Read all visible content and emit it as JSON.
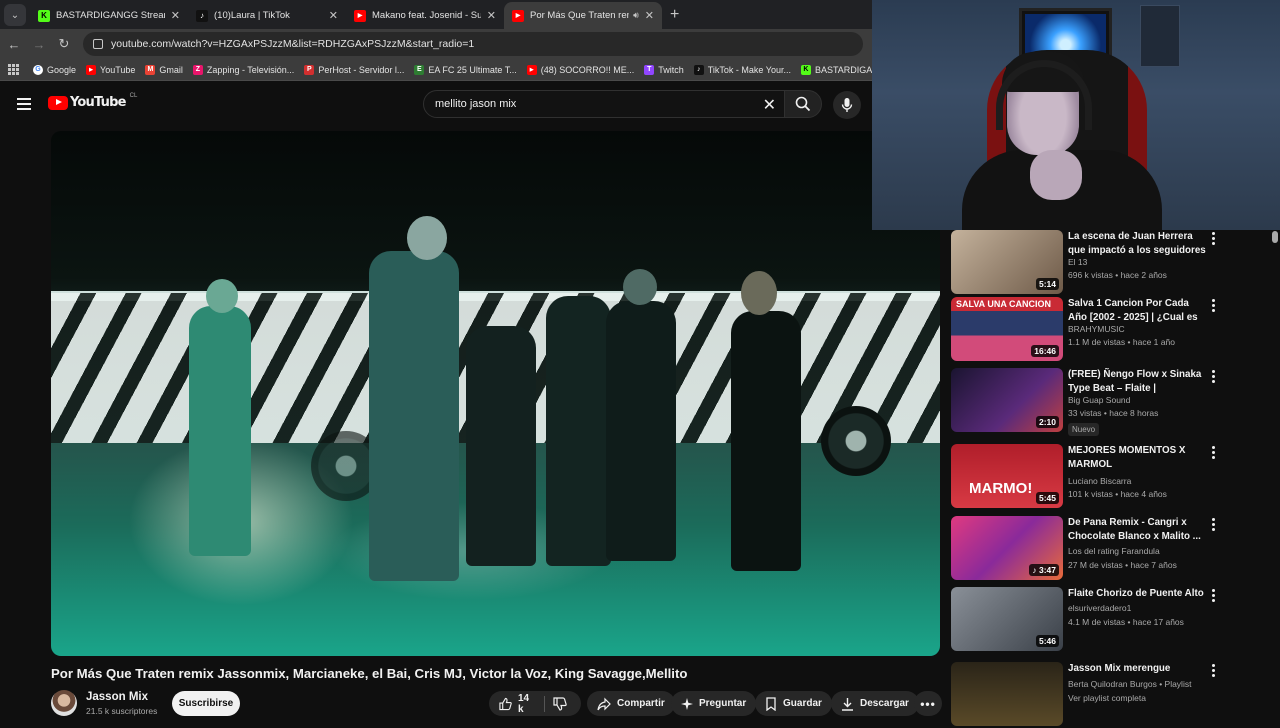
{
  "browser": {
    "tabs": [
      {
        "title": "BASTARDIGANGG Stream - Wat",
        "color": "#53fc18",
        "glyph": "K"
      },
      {
        "title": "(10)Laura | TikTok",
        "color": "#111111",
        "glyph": "♪"
      },
      {
        "title": "Makano feat. Josenid - Su Nom",
        "color": "#ff0000",
        "glyph": "▶"
      },
      {
        "title": "Por Más Que Traten remix J",
        "color": "#ff0000",
        "glyph": "▶"
      }
    ],
    "url": "youtube.com/watch?v=HZGAxPSJzzM&list=RDHZGAxPSJzzM&start_radio=1",
    "bookmarks": [
      {
        "label": "Google",
        "color": "#4285f4",
        "glyph": "G"
      },
      {
        "label": "YouTube",
        "color": "#ff0000",
        "glyph": "▶"
      },
      {
        "label": "Gmail",
        "color": "#ea4335",
        "glyph": "M"
      },
      {
        "label": "Zapping - Televisión...",
        "color": "#e9156b",
        "glyph": "Z"
      },
      {
        "label": "PerHost - Servidor l...",
        "color": "#d32f2f",
        "glyph": "P"
      },
      {
        "label": "EA FC 25 Ultimate T...",
        "color": "#2e7d32",
        "glyph": "E"
      },
      {
        "label": "(48) SOCORRO!! ME...",
        "color": "#ff0000",
        "glyph": "▶"
      },
      {
        "label": "Twitch",
        "color": "#9146ff",
        "glyph": "T"
      },
      {
        "label": "TikTok - Make Your...",
        "color": "#111111",
        "glyph": "♪"
      },
      {
        "label": "BASTARDIGANGG |...",
        "color": "#53fc18",
        "glyph": "K"
      }
    ]
  },
  "youtube": {
    "logo_text": "YouTube",
    "country_code": "CL",
    "search_query": "mellito jason mix"
  },
  "video": {
    "title": "Por Más Que Traten remix Jassonmix, Marcianeke, el Bai, Cris MJ, Victor la Voz, King Savagge,Mellito",
    "channel": "Jasson Mix",
    "subscribers": "21.5 k suscriptores",
    "subscribe_label": "Suscribirse",
    "likes": "14 k",
    "share_label": "Compartir",
    "ask_label": "Preguntar",
    "save_label": "Guardar",
    "download_label": "Descargar"
  },
  "recommendations": [
    {
      "title": "La escena de Juan Herrera que impactó a los seguidores en lo...",
      "channel": "El 13",
      "meta": "696 k vistas • hace 2 años",
      "duration": "5:14",
      "thumb": "#8a7a68"
    },
    {
      "title": "Salva 1 Cancion Por Cada Año [2002 - 2025] | ¿Cual es tu ...",
      "channel": "BRAHYMUSIC",
      "meta": "1.1 M de vistas • hace 1 año",
      "duration": "16:46",
      "thumb": "#b8323a",
      "thumb_text": "SALVA UNA CANCION"
    },
    {
      "title": "(FREE) Ñengo Flow x Sinaka Type Beat – Flaite | Reggaeton...",
      "channel": "Big Guap Sound",
      "meta": "33 vistas • hace 8 horas",
      "duration": "2:10",
      "thumb": "#3a2a5a",
      "badge": "Nuevo"
    },
    {
      "title": "MEJORES MOMENTOS X MARMOL",
      "channel": "Luciano Biscarra",
      "meta": "101 k vistas • hace 4 años",
      "duration": "5:45",
      "thumb": "#c0202a",
      "thumb_text": "MARMO!"
    },
    {
      "title": "De Pana Remix - Cangri x Chocolate Blanco x Malito ...",
      "channel": "Los del rating Farandula",
      "meta": "27 M de vistas • hace 7 años",
      "duration": "♪ 3:47",
      "thumb": "#d0306a"
    },
    {
      "title": "Flaite Chorizo de Puente Alto",
      "channel": "elsuriverdadero1",
      "meta": "4.1 M de vistas • hace 17 años",
      "duration": "5:46",
      "thumb": "#5a6068"
    },
    {
      "title": "Jasson Mix merengue",
      "channel": "Berta Quilodran Burgos • Playlist",
      "meta": "Ver playlist completa",
      "duration": "",
      "thumb": "#3a3020"
    }
  ]
}
